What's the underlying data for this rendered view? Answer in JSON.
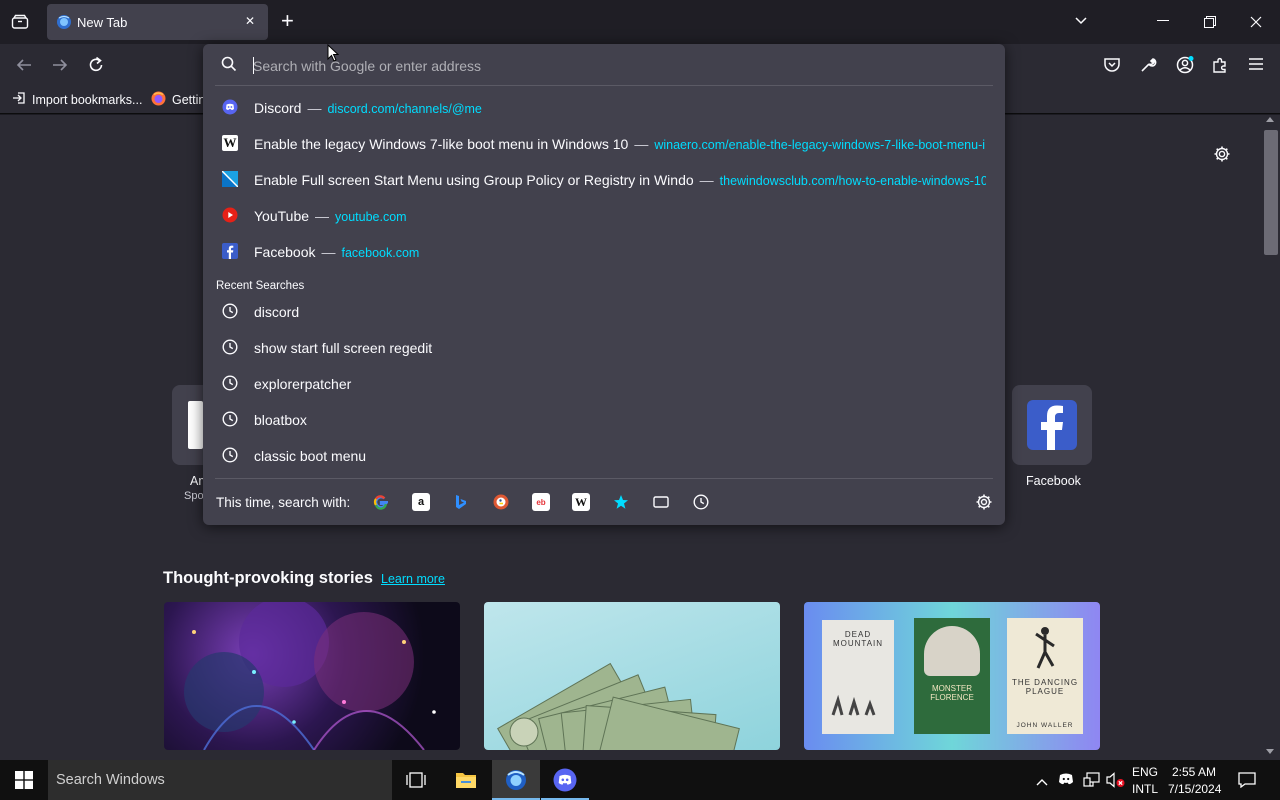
{
  "browser": {
    "tab": {
      "title": "New Tab",
      "close_glyph": "✕"
    },
    "new_tab_glyph": "+",
    "list_tabs_glyph": "⌄",
    "window_controls": {
      "minimize": "—",
      "restore": "❐",
      "close": "✕"
    }
  },
  "navbar": {
    "back_icon": "arrow-left-icon",
    "forward_icon": "arrow-right-icon",
    "reload_icon": "reload-icon",
    "right_icons": [
      "pocket-icon",
      "wrench-icon",
      "account-icon",
      "extensions-icon",
      "menu-icon"
    ]
  },
  "bookmarks": [
    {
      "label": "Import bookmarks...",
      "icon": "import-icon"
    },
    {
      "label": "Gettin",
      "icon": "firefox-icon"
    }
  ],
  "urlbar": {
    "placeholder": "Search with Google or enter address",
    "value": ""
  },
  "suggestions": [
    {
      "title": "Discord",
      "url": "discord.com/channels/@me",
      "icon": "discord-icon"
    },
    {
      "title": "Enable the legacy Windows 7-like boot menu in Windows 10",
      "url": "winaero.com/enable-the-legacy-windows-7-like-boot-menu-i",
      "icon": "winaero-icon"
    },
    {
      "title": "Enable Full screen Start Menu using Group Policy or Registry in Windo",
      "url": "thewindowsclub.com/how-to-enable-windows-10-",
      "icon": "windowsclub-icon"
    },
    {
      "title": "YouTube",
      "url": "youtube.com",
      "icon": "youtube-icon"
    },
    {
      "title": "Facebook",
      "url": "facebook.com",
      "icon": "facebook-icon"
    }
  ],
  "recent": {
    "header": "Recent Searches",
    "items": [
      "discord",
      "show start full screen regedit",
      "explorerpatcher",
      "bloatbox",
      "classic boot menu"
    ]
  },
  "search_with": {
    "label": "This time, search with:",
    "engines": [
      "google-icon",
      "amazon-icon",
      "bing-icon",
      "duckduckgo-icon",
      "ebay-icon",
      "wikipedia-icon",
      "bookmarks-star-icon",
      "tabs-icon",
      "history-icon"
    ]
  },
  "newtab": {
    "tiles": [
      {
        "label_partial": "Am",
        "sublabel_partial": "Spo"
      },
      {
        "label": "Facebook"
      }
    ],
    "stories_heading": "Thought-provoking stories",
    "learn_more": "Learn more"
  },
  "book_covers": [
    "DEAD MOUNTAIN",
    "MONSTER FLORENCE",
    "THE DANCING PLAGUE",
    "JOHN WALLER"
  ],
  "taskbar": {
    "search_placeholder": "Search Windows",
    "lang_top": "ENG",
    "lang_bottom": "INTL",
    "time": "2:55 AM",
    "date": "7/15/2024"
  },
  "colors": {
    "accent": "#00ddff",
    "panel": "#42414d",
    "toolbar": "#2b2a33",
    "taskbar": "#101010"
  }
}
